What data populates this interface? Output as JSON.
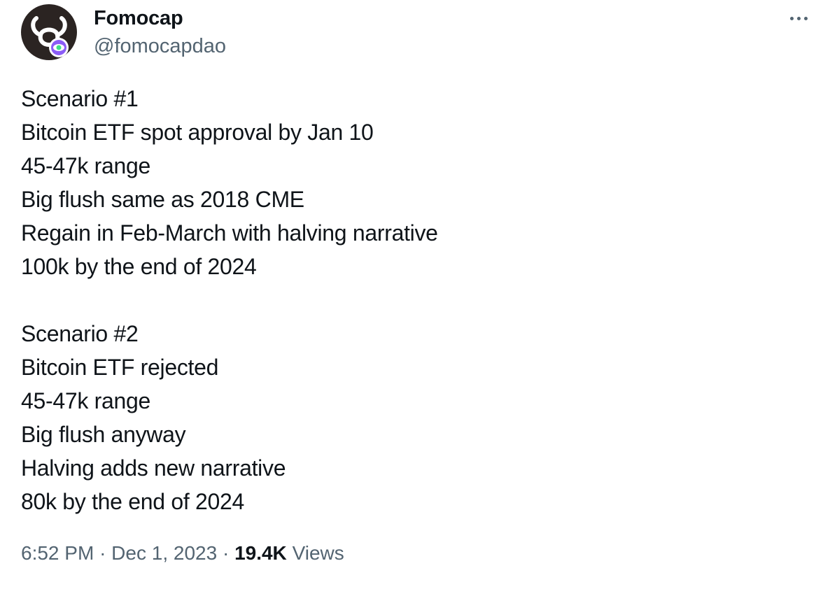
{
  "author": {
    "name": "Fomocap",
    "handle": "@fomocapdao",
    "avatar_icon": "bull-head-eye-logo",
    "avatar_colors": {
      "background": "#2b2422",
      "logo": "#ffffff",
      "badge_ring": "#8b5cf6",
      "badge_eye": "#3ee08a"
    }
  },
  "menu": {
    "more_icon": "more-horizontal-icon"
  },
  "tweet": {
    "lines": [
      "Scenario #1",
      "Bitcoin ETF spot approval by Jan 10",
      "45-47k range",
      "Big flush same as 2018 CME",
      "Regain in Feb-March with halving narrative",
      "100k by the end of 2024",
      "",
      "Scenario #2",
      "Bitcoin ETF rejected",
      "45-47k range",
      "Big flush anyway",
      "Halving adds new narrative",
      "80k by the end of 2024"
    ]
  },
  "meta": {
    "time": "6:52 PM",
    "separator": "·",
    "date": "Dec 1, 2023",
    "views_count": "19.4K",
    "views_label": "Views"
  }
}
